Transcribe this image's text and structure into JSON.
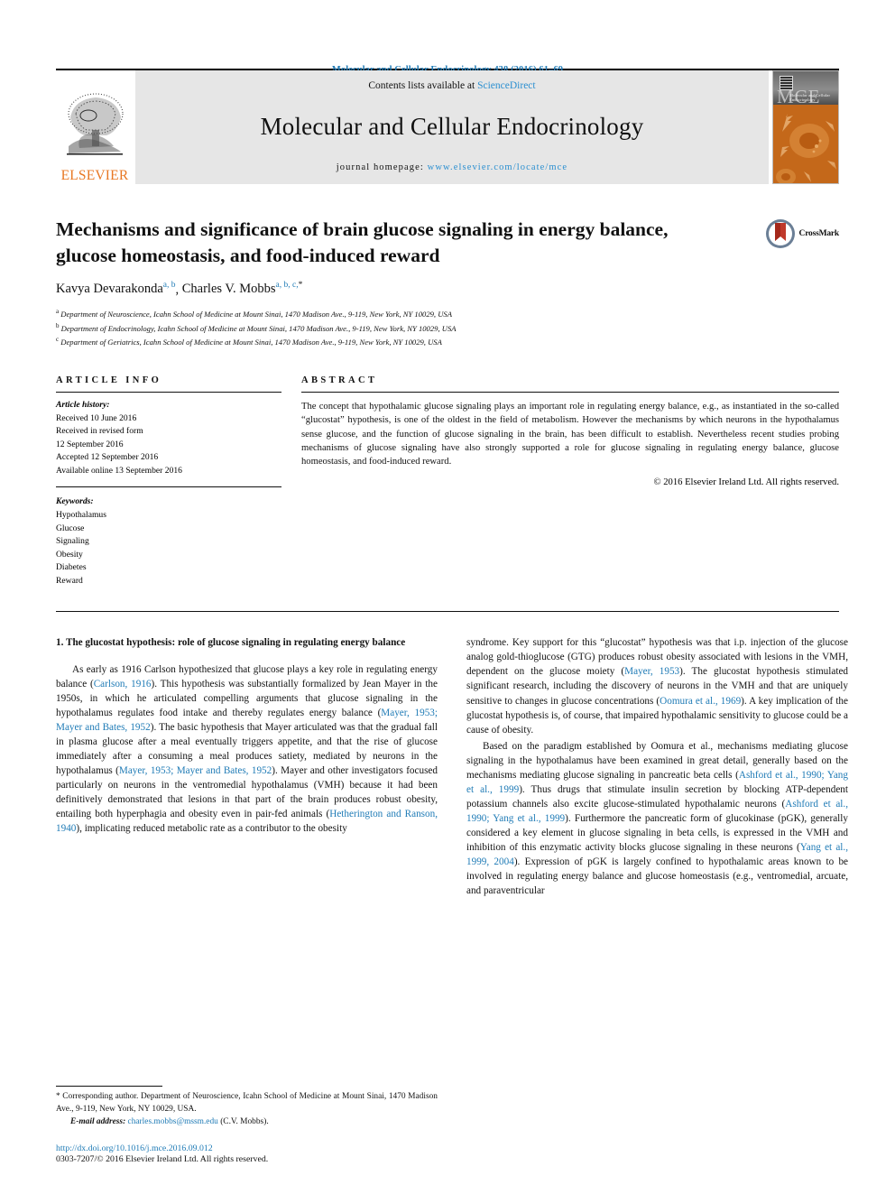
{
  "running_head": "Molecular and Cellular Endocrinology 438 (2016) 61–69",
  "masthead": {
    "publisher_name": "ELSEVIER",
    "contents_prefix": "Contents lists available at ",
    "contents_link": "ScienceDirect",
    "journal_title": "Molecular and Cellular Endocrinology",
    "homepage_prefix": "journal homepage: ",
    "homepage_url": "www.elsevier.com/locate/mce",
    "cover_title": "MCE",
    "cover_subtitle": "Molecular and Cellular Endocrinology"
  },
  "article": {
    "title": "Mechanisms and significance of brain glucose signaling in energy balance, glucose homeostasis, and food-induced reward",
    "authors": [
      {
        "name": "Kavya Devarakonda",
        "marks": "a, b",
        "star": false
      },
      {
        "name": "Charles V. Mobbs",
        "marks": "a, b, c,",
        "star": true
      }
    ],
    "affiliations": [
      {
        "mark": "a",
        "text": "Department of Neuroscience, Icahn School of Medicine at Mount Sinai, 1470 Madison Ave., 9-119, New York, NY 10029, USA"
      },
      {
        "mark": "b",
        "text": "Department of Endocrinology, Icahn School of Medicine at Mount Sinai, 1470 Madison Ave., 9-119, New York, NY 10029, USA"
      },
      {
        "mark": "c",
        "text": "Department of Geriatrics, Icahn School of Medicine at Mount Sinai, 1470 Madison Ave., 9-119, New York, NY 10029, USA"
      }
    ],
    "crossmark_label": "CrossMark"
  },
  "article_info": {
    "heading": "ARTICLE INFO",
    "history_label": "Article history:",
    "history": [
      "Received 10 June 2016",
      "Received in revised form",
      "12 September 2016",
      "Accepted 12 September 2016",
      "Available online 13 September 2016"
    ],
    "keywords_label": "Keywords:",
    "keywords": [
      "Hypothalamus",
      "Glucose",
      "Signaling",
      "Obesity",
      "Diabetes",
      "Reward"
    ]
  },
  "abstract": {
    "heading": "ABSTRACT",
    "text": "The concept that hypothalamic glucose signaling plays an important role in regulating energy balance, e.g., as instantiated in the so-called “glucostat” hypothesis, is one of the oldest in the field of metabolism. However the mechanisms by which neurons in the hypothalamus sense glucose, and the function of glucose signaling in the brain, has been difficult to establish. Nevertheless recent studies probing mechanisms of glucose signaling have also strongly supported a role for glucose signaling in regulating energy balance, glucose homeostasis, and food-induced reward.",
    "copyright": "© 2016 Elsevier Ireland Ltd. All rights reserved."
  },
  "body": {
    "section_heading": "1. The glucostat hypothesis: role of glucose signaling in regulating energy balance",
    "left_paragraph_1": [
      {
        "t": "As early as 1916 Carlson hypothesized that glucose plays a key role in regulating energy balance (",
        "c": false
      },
      {
        "t": "Carlson, 1916",
        "c": true
      },
      {
        "t": "). This hypothesis was substantially formalized by Jean Mayer in the 1950s, in which he articulated compelling arguments that glucose signaling in the hypothalamus regulates food intake and thereby regulates energy balance (",
        "c": false
      },
      {
        "t": "Mayer, 1953; Mayer and Bates, 1952",
        "c": true
      },
      {
        "t": "). The basic hypothesis that Mayer articulated was that the gradual fall in plasma glucose after a meal eventually triggers appetite, and that the rise of glucose immediately after a consuming a meal produces satiety, mediated by neurons in the hypothalamus (",
        "c": false
      },
      {
        "t": "Mayer, 1953; Mayer and Bates, 1952",
        "c": true
      },
      {
        "t": "). Mayer and other investigators focused particularly on neurons in the ventromedial hypothalamus (VMH) because it had been definitively demonstrated that lesions in that part of the brain produces robust obesity, entailing both hyperphagia and obesity even in pair-fed animals (",
        "c": false
      },
      {
        "t": "Hetherington and Ranson, 1940",
        "c": true
      },
      {
        "t": "), implicating reduced metabolic rate as a contributor to the obesity",
        "c": false
      }
    ],
    "right_paragraph_1": [
      {
        "t": "syndrome. Key support for this “glucostat” hypothesis was that i.p. injection of the glucose analog gold-thioglucose (GTG) produces robust obesity associated with lesions in the VMH, dependent on the glucose moiety (",
        "c": false
      },
      {
        "t": "Mayer, 1953",
        "c": true
      },
      {
        "t": "). The glucostat hypothesis stimulated significant research, including the discovery of neurons in the VMH and that are uniquely sensitive to changes in glucose concentrations (",
        "c": false
      },
      {
        "t": "Oomura et al., 1969",
        "c": true
      },
      {
        "t": "). A key implication of the glucostat hypothesis is, of course, that impaired hypothalamic sensitivity to glucose could be a cause of obesity.",
        "c": false
      }
    ],
    "right_paragraph_2": [
      {
        "t": "Based on the paradigm established by Oomura et al., mechanisms mediating glucose signaling in the hypothalamus have been examined in great detail, generally based on the mechanisms mediating glucose signaling in pancreatic beta cells (",
        "c": false
      },
      {
        "t": "Ashford et al., 1990; Yang et al., 1999",
        "c": true
      },
      {
        "t": "). Thus drugs that stimulate insulin secretion by blocking ATP-dependent potassium channels also excite glucose-stimulated hypothalamic neurons (",
        "c": false
      },
      {
        "t": "Ashford et al., 1990; Yang et al., 1999",
        "c": true
      },
      {
        "t": "). Furthermore the pancreatic form of glucokinase (pGK), generally considered a key element in glucose signaling in beta cells, is expressed in the VMH and inhibition of this enzymatic activity blocks glucose signaling in these neurons (",
        "c": false
      },
      {
        "t": "Yang et al., 1999, 2004",
        "c": true
      },
      {
        "t": "). Expression of pGK is largely confined to hypothalamic areas known to be involved in regulating energy balance and glucose homeostasis (e.g., ventromedial, arcuate, and paraventricular",
        "c": false
      }
    ]
  },
  "footnotes": {
    "corresponding": "* Corresponding author. Department of Neuroscience, Icahn School of Medicine at Mount Sinai, 1470 Madison Ave., 9-119, New York, NY 10029, USA.",
    "email_label": "E-mail address:",
    "email": "charles.mobbs@mssm.edu",
    "email_suffix": "(C.V. Mobbs).",
    "doi": "http://dx.doi.org/10.1016/j.mce.2016.09.012",
    "issn": "0303-7207/© 2016 Elsevier Ireland Ltd. All rights reserved."
  },
  "colors": {
    "link": "#1f7bb6",
    "elsevier_orange": "#e87722",
    "band_gray": "#e6e6e6",
    "cover_orange": "#c4681a"
  }
}
